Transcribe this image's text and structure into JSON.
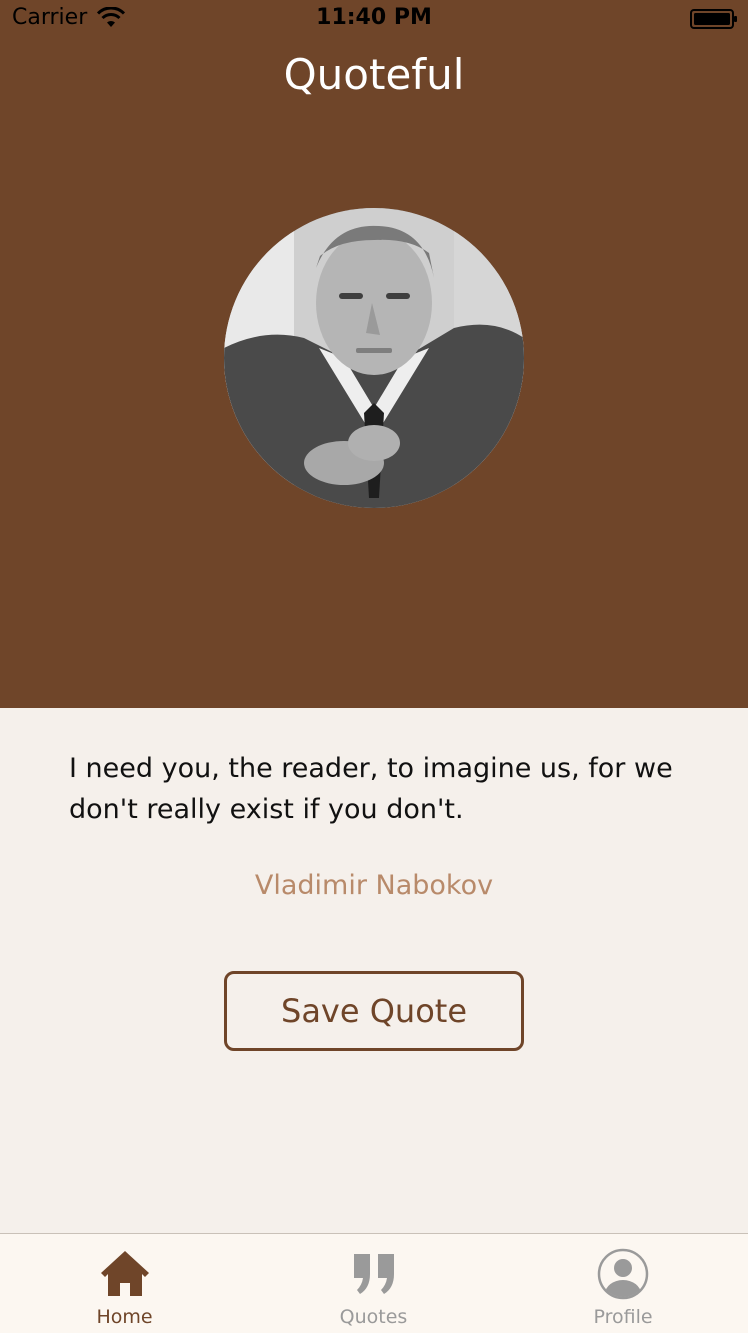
{
  "status_bar": {
    "carrier": "Carrier",
    "time": "11:40 PM"
  },
  "header": {
    "title": "Quoteful",
    "background": "#6f4529"
  },
  "quote": {
    "text": "I need you, the reader, to imagine us, for we don't really exist if you don't.",
    "author": "Vladimir Nabokov",
    "save_label": "Save Quote"
  },
  "tab_bar": {
    "items": [
      {
        "label": "Home",
        "icon": "home-icon",
        "active": true
      },
      {
        "label": "Quotes",
        "icon": "quote-icon",
        "active": false
      },
      {
        "label": "Profile",
        "icon": "profile-icon",
        "active": false
      }
    ]
  },
  "colors": {
    "accent": "#6f4529",
    "author": "#b88a6a",
    "body_background": "#f5f0eb",
    "tab_inactive": "#9a9a9a"
  }
}
